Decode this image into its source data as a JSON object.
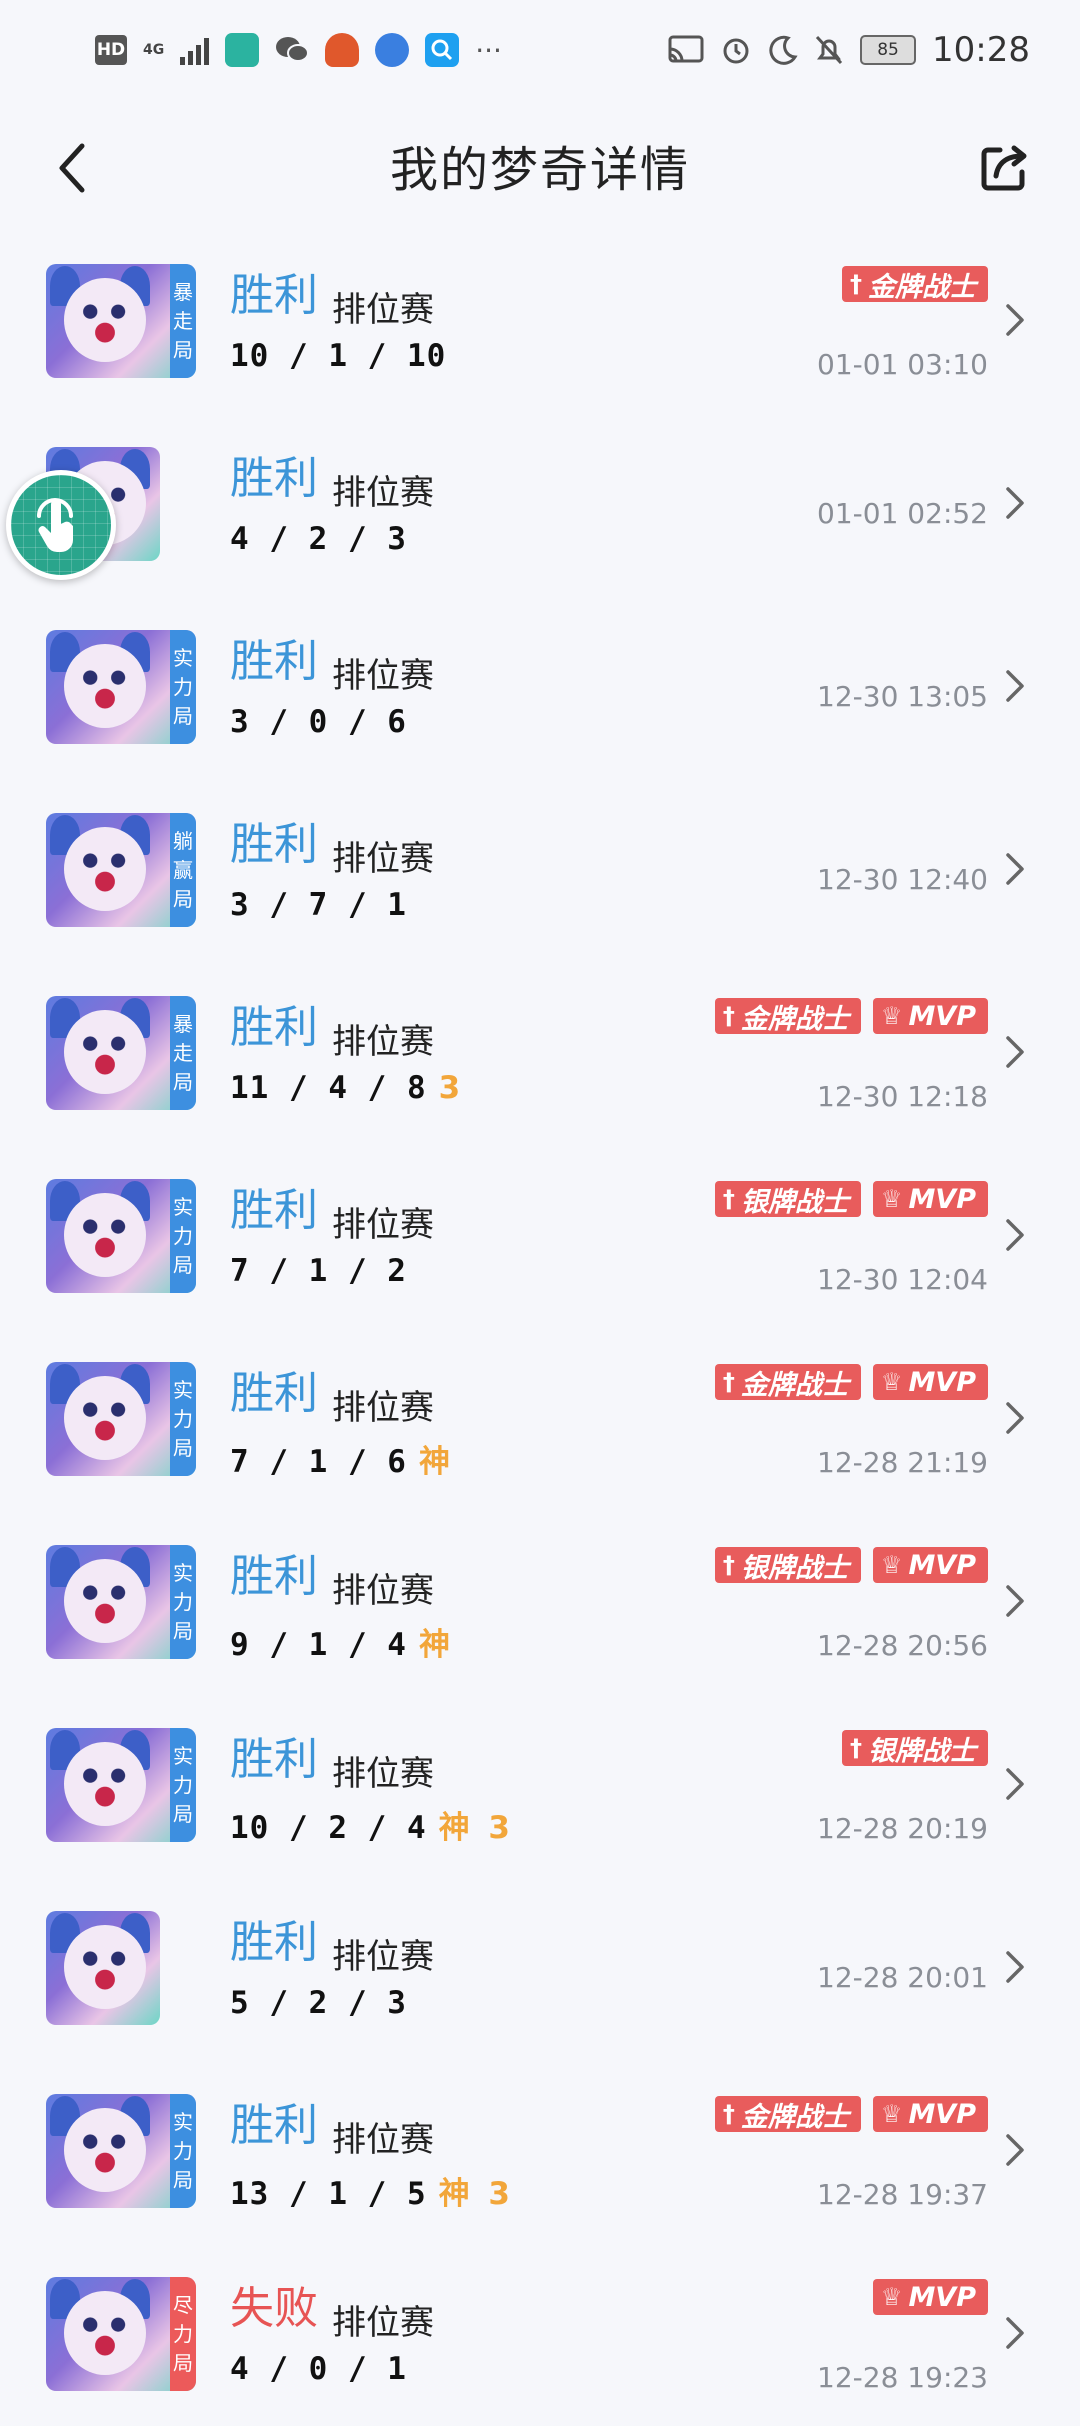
{
  "status_bar": {
    "hd": "HD",
    "network": "4G",
    "time": "10:28",
    "battery": "85",
    "more": "···",
    "icons": [
      "hd-icon",
      "signal-icon",
      "screenshot-app-icon",
      "wechat-icon",
      "app-icon",
      "browser-icon",
      "search-app-icon",
      "cast-icon",
      "alarm-icon",
      "moon-icon",
      "mute-icon",
      "battery-icon"
    ]
  },
  "header": {
    "title": "我的梦奇详情",
    "back_icon": "back-icon",
    "share_icon": "share-icon"
  },
  "colors": {
    "win": "#3c95d8",
    "lose": "#e75454",
    "badge": "#e85c5c",
    "tag_blue": "#3d8fe0",
    "tag_red": "#ec5a5a",
    "extra": "#f2a63a"
  },
  "matches": [
    {
      "result": "胜利",
      "result_type": "win",
      "mode": "排位赛",
      "kda": "10 / 1 / 10",
      "extra": "",
      "tag": "暴走局",
      "tag_color": "blue",
      "badges": [
        "金牌战士"
      ],
      "time": "01-01 03:10"
    },
    {
      "result": "胜利",
      "result_type": "win",
      "mode": "排位赛",
      "kda": "4 / 2 / 3",
      "extra": "",
      "tag": "",
      "tag_color": "",
      "badges": [],
      "time": "01-01 02:52"
    },
    {
      "result": "胜利",
      "result_type": "win",
      "mode": "排位赛",
      "kda": "3 / 0 / 6",
      "extra": "",
      "tag": "实力局",
      "tag_color": "blue",
      "badges": [],
      "time": "12-30 13:05"
    },
    {
      "result": "胜利",
      "result_type": "win",
      "mode": "排位赛",
      "kda": "3 / 7 / 1",
      "extra": "",
      "tag": "躺赢局",
      "tag_color": "blue",
      "badges": [],
      "time": "12-30 12:40"
    },
    {
      "result": "胜利",
      "result_type": "win",
      "mode": "排位赛",
      "kda": "11 / 4 / 8",
      "extra": "3",
      "tag": "暴走局",
      "tag_color": "blue",
      "badges": [
        "金牌战士",
        "MVP"
      ],
      "time": "12-30 12:18"
    },
    {
      "result": "胜利",
      "result_type": "win",
      "mode": "排位赛",
      "kda": "7 / 1 / 2",
      "extra": "",
      "tag": "实力局",
      "tag_color": "blue",
      "badges": [
        "银牌战士",
        "MVP"
      ],
      "time": "12-30 12:04"
    },
    {
      "result": "胜利",
      "result_type": "win",
      "mode": "排位赛",
      "kda": "7 / 1 / 6",
      "extra": "神",
      "tag": "实力局",
      "tag_color": "blue",
      "badges": [
        "金牌战士",
        "MVP"
      ],
      "time": "12-28 21:19"
    },
    {
      "result": "胜利",
      "result_type": "win",
      "mode": "排位赛",
      "kda": "9 / 1 / 4",
      "extra": "神",
      "tag": "实力局",
      "tag_color": "blue",
      "badges": [
        "银牌战士",
        "MVP"
      ],
      "time": "12-28 20:56"
    },
    {
      "result": "胜利",
      "result_type": "win",
      "mode": "排位赛",
      "kda": "10 / 2 / 4",
      "extra": "神 3",
      "tag": "实力局",
      "tag_color": "blue",
      "badges": [
        "银牌战士"
      ],
      "time": "12-28 20:19"
    },
    {
      "result": "胜利",
      "result_type": "win",
      "mode": "排位赛",
      "kda": "5 / 2 / 3",
      "extra": "",
      "tag": "",
      "tag_color": "",
      "badges": [],
      "time": "12-28 20:01"
    },
    {
      "result": "胜利",
      "result_type": "win",
      "mode": "排位赛",
      "kda": "13 / 1 / 5",
      "extra": "神 3",
      "tag": "实力局",
      "tag_color": "blue",
      "badges": [
        "金牌战士",
        "MVP"
      ],
      "time": "12-28 19:37"
    },
    {
      "result": "失败",
      "result_type": "lose",
      "mode": "排位赛",
      "kda": "4 / 0 / 1",
      "extra": "",
      "tag": "尽力局",
      "tag_color": "red",
      "badges": [
        "MVP"
      ],
      "time": "12-28 19:23"
    }
  ]
}
